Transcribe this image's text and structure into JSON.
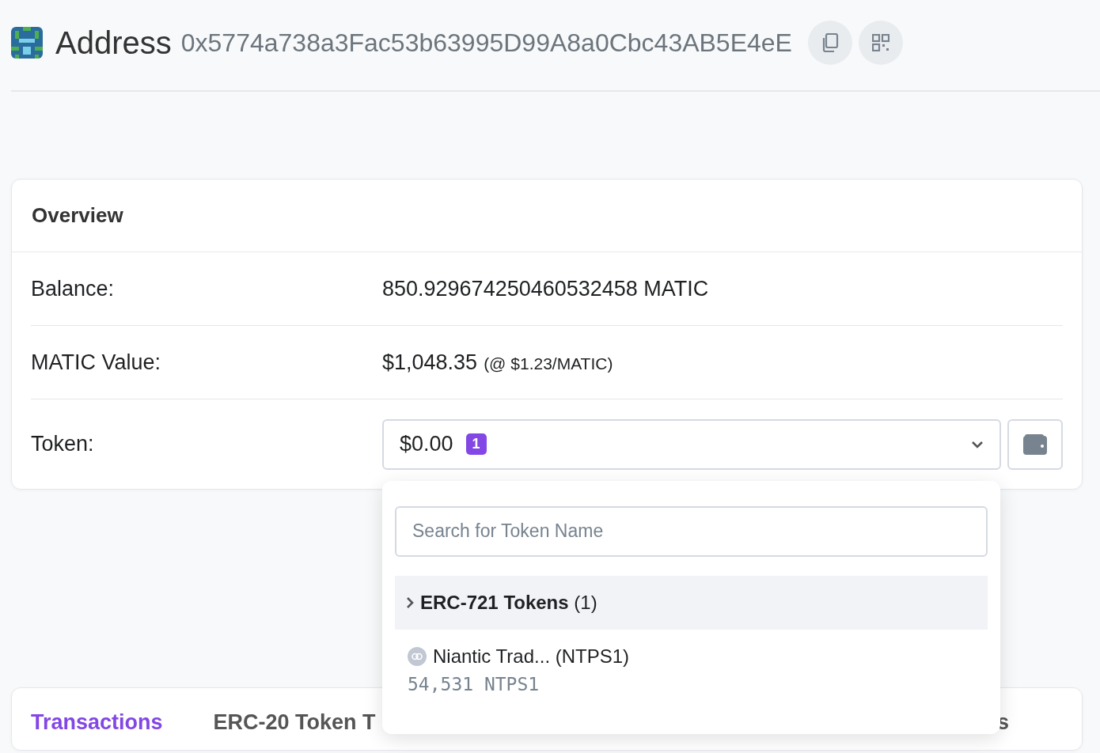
{
  "header": {
    "title": "Address",
    "address": "0x5774a738a3Fac53b63995D99A8a0Cbc43AB5E4eE"
  },
  "overview": {
    "title": "Overview",
    "rows": [
      {
        "kind": "text",
        "label": "Balance:",
        "value": "850.929674250460532458 MATIC"
      },
      {
        "kind": "price",
        "label": "MATIC Value:",
        "value": "$1,048.35",
        "note": "(@ $1.23/MATIC)"
      },
      {
        "kind": "token",
        "label": "Token:",
        "value": "$0.00",
        "badge": "1"
      }
    ]
  },
  "token_dropdown": {
    "open": true,
    "search": {
      "placeholder": "Search for Token Name"
    },
    "groups": [
      {
        "title": "ERC-721 Tokens",
        "count": "(1)",
        "expanded": false
      }
    ],
    "items": [
      {
        "name": "Niantic Trad... (NTPS1)",
        "amount": "54,531 NTPS1"
      }
    ]
  },
  "tabs": [
    {
      "label": "Transactions",
      "selected": true
    },
    {
      "label": "ERC-20 Token T",
      "selected": false
    },
    {
      "label": "s",
      "selected": false
    }
  ]
}
